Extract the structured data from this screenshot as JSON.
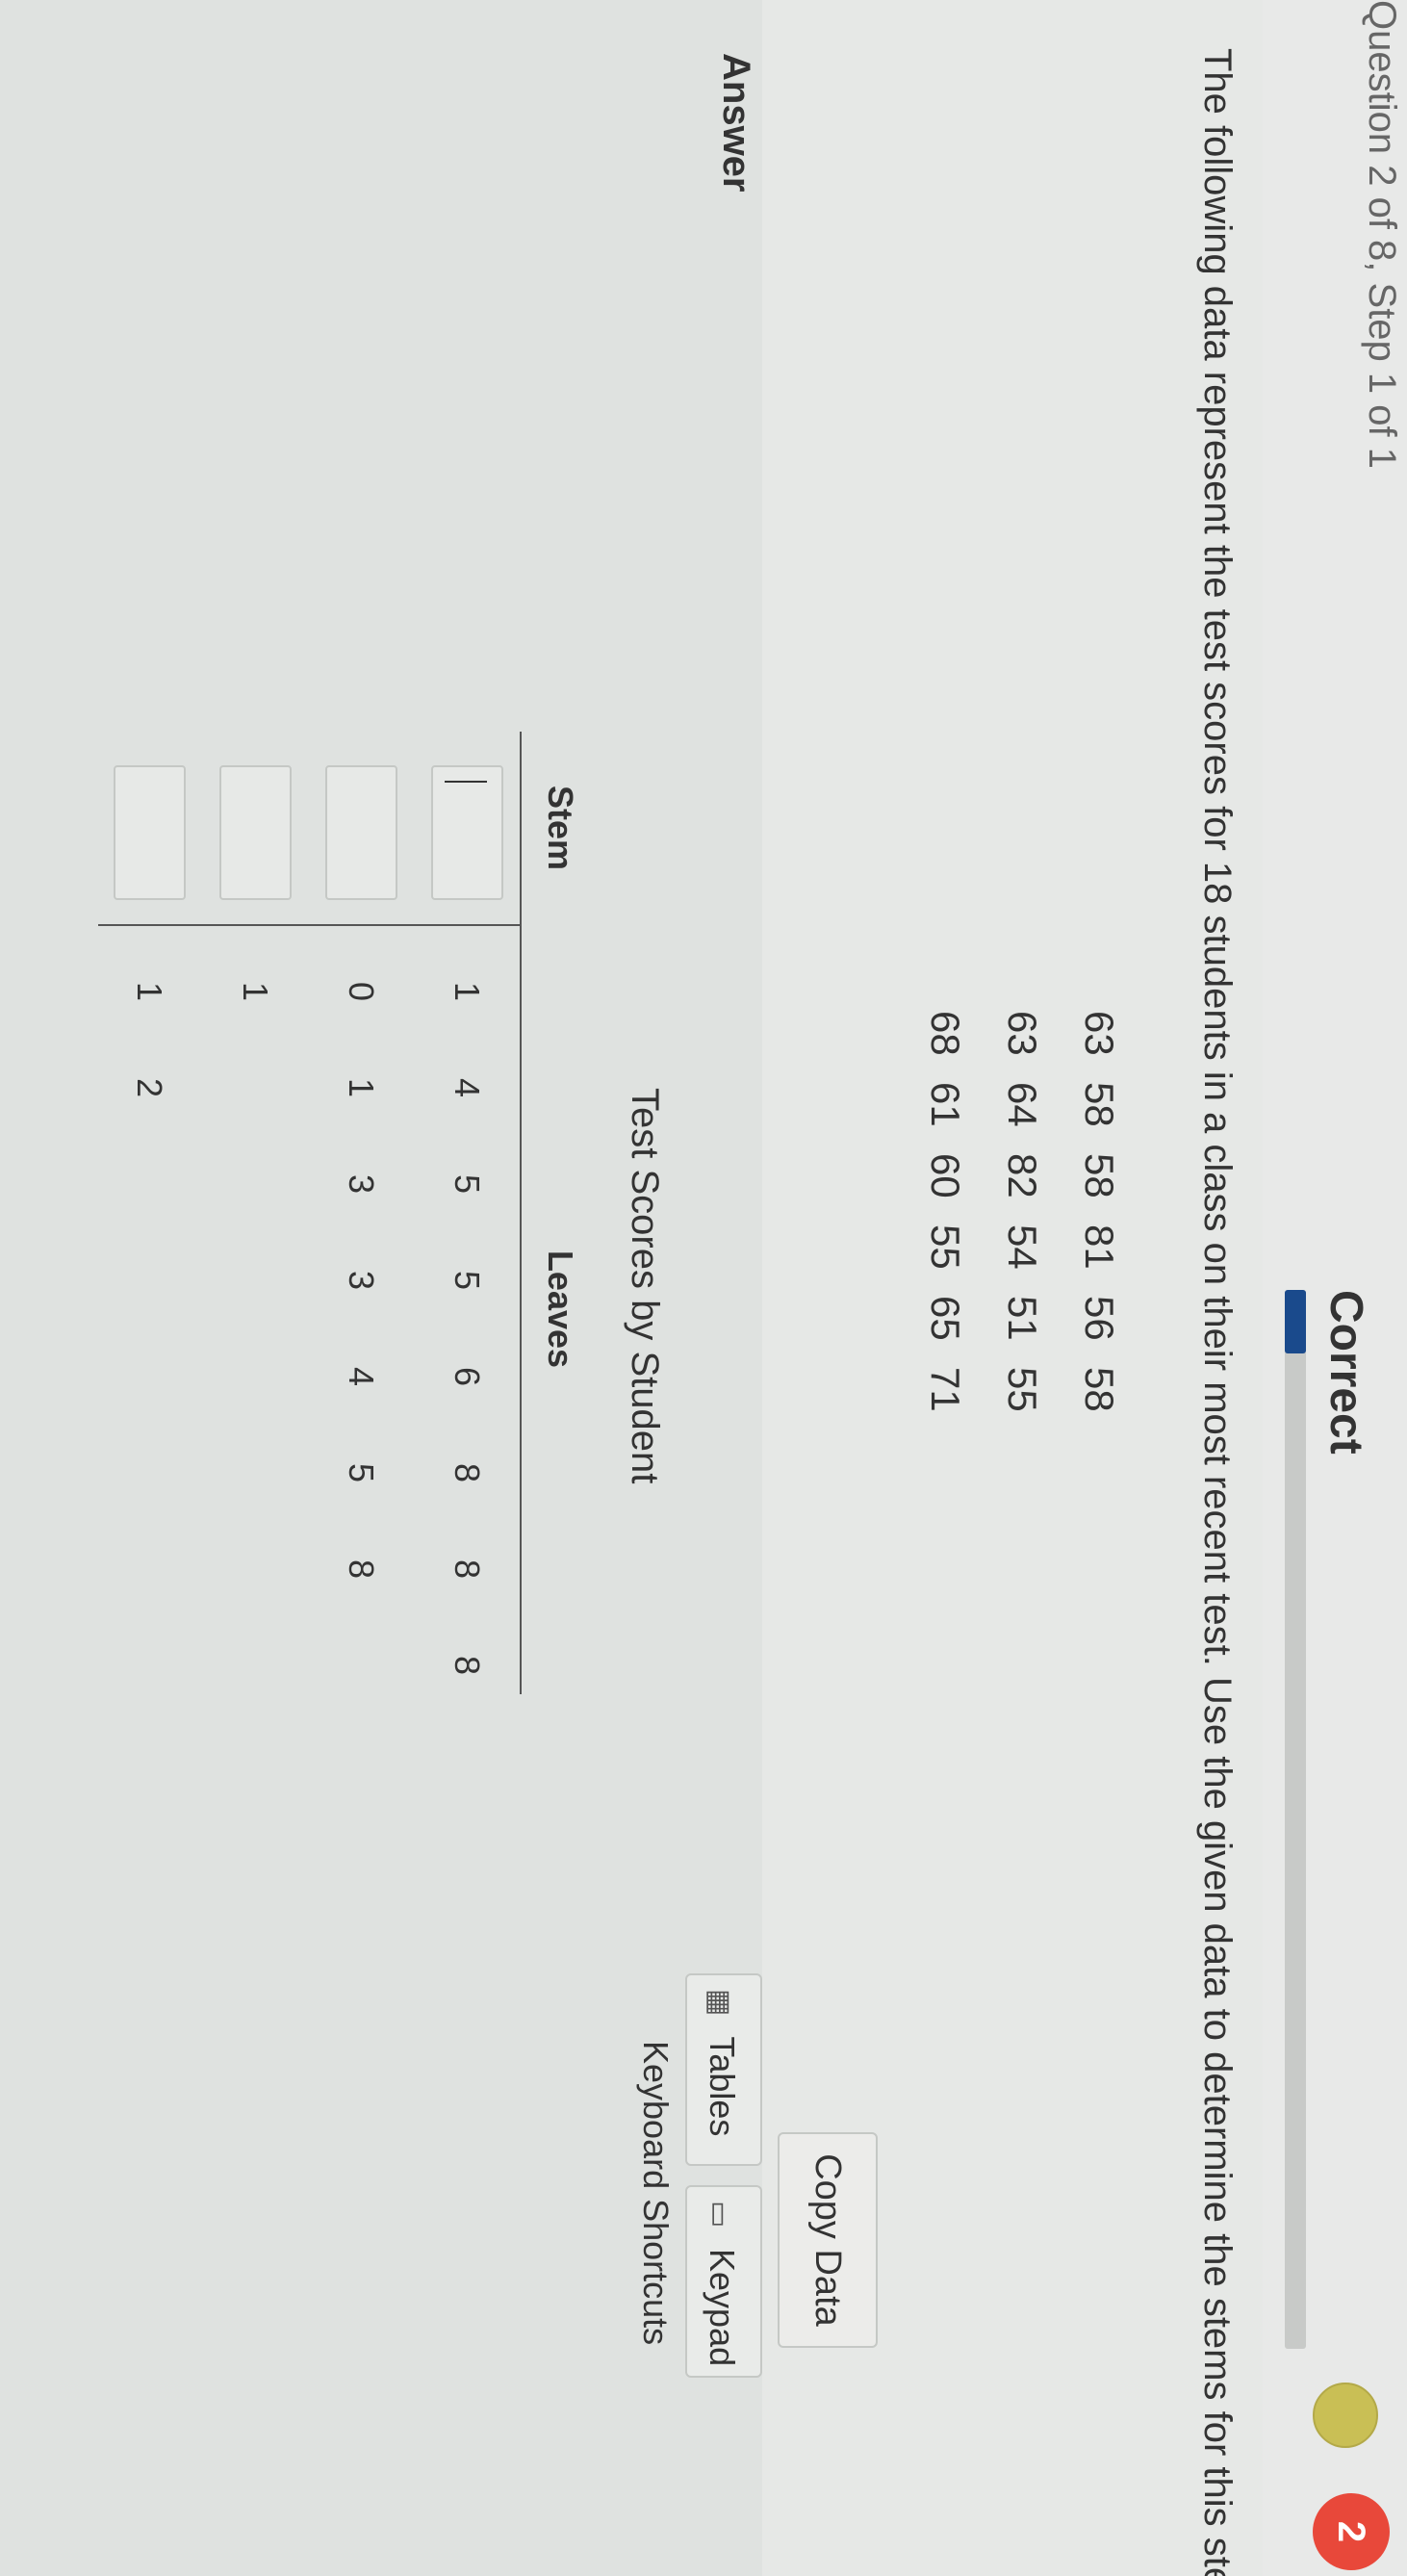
{
  "header": {
    "breadcrumb": "Question 2 of 8, Step 1 of 1",
    "status": "Correct",
    "progress": 0.06,
    "counter": "2"
  },
  "question": {
    "prompt": "The following data represent the test scores for 18 students in a class on their most recent test. Use the given data to determine the stems for this stem-and-leaf plot.",
    "data_rows": [
      [
        "63",
        "58",
        "58",
        "81",
        "56",
        "58"
      ],
      [
        "63",
        "64",
        "82",
        "54",
        "51",
        "55"
      ],
      [
        "68",
        "61",
        "60",
        "55",
        "65",
        "71"
      ]
    ],
    "copy_data_label": "Copy Data"
  },
  "answer": {
    "label": "Answer",
    "tables_label": "Tables",
    "keypad_label": "Keypad",
    "shortcuts_label": "Keyboard Shortcuts"
  },
  "chart_data": {
    "type": "table",
    "title": "Test Scores by Student",
    "columns": [
      "Stem",
      "Leaves"
    ],
    "rows": [
      {
        "stem": "",
        "leaves": [
          "1",
          "4",
          "5",
          "5",
          "6",
          "8",
          "8",
          "8"
        ]
      },
      {
        "stem": "",
        "leaves": [
          "0",
          "1",
          "3",
          "3",
          "4",
          "5",
          "8"
        ]
      },
      {
        "stem": "",
        "leaves": [
          "1"
        ]
      },
      {
        "stem": "",
        "leaves": [
          "1",
          "2"
        ]
      }
    ]
  }
}
